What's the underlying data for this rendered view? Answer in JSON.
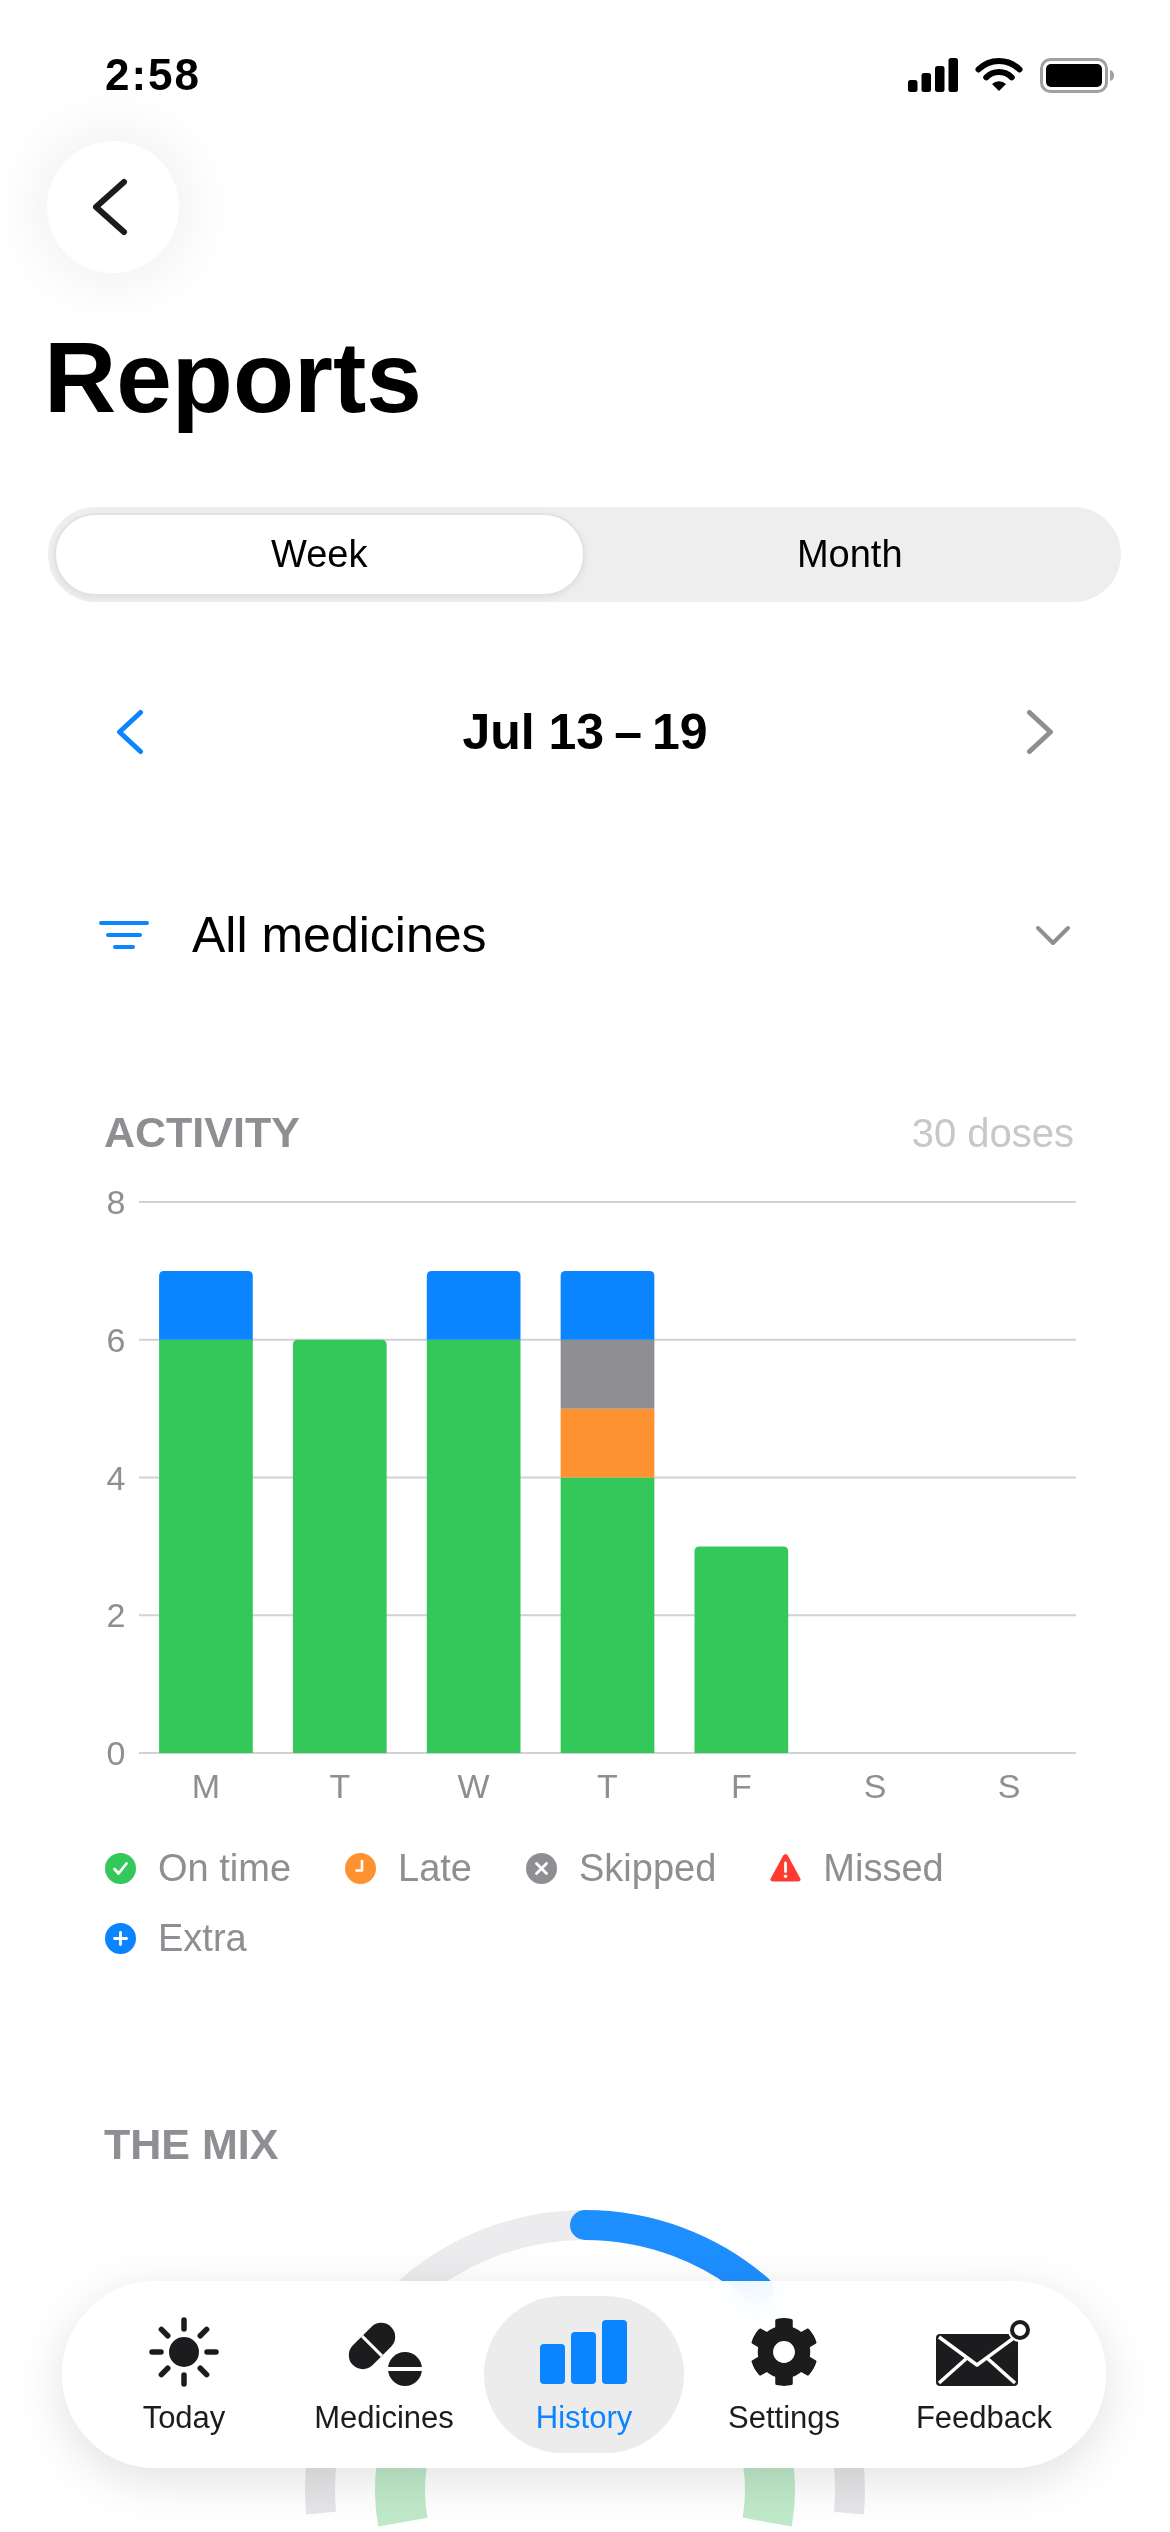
{
  "status_bar": {
    "time": "2:58"
  },
  "header": {
    "title": "Reports"
  },
  "period_tabs": [
    {
      "label": "Week",
      "selected": true
    },
    {
      "label": "Month",
      "selected": false
    }
  ],
  "date_nav": {
    "range": "Jul 13 – 19",
    "previous_disabled": false,
    "next_disabled": true
  },
  "filter": {
    "value": "All medicines"
  },
  "activity": {
    "title": "ACTIVITY",
    "total": "30 doses",
    "chart_data": {
      "type": "bar",
      "stacked": true,
      "grid": true,
      "categories": [
        "M",
        "T",
        "W",
        "T",
        "F",
        "S",
        "S"
      ],
      "series": [
        {
          "name": "On time",
          "color": "#34c759",
          "values": [
            6,
            6,
            6,
            4,
            3,
            0,
            0
          ]
        },
        {
          "name": "Late",
          "color": "#ff9230",
          "values": [
            0,
            0,
            0,
            1,
            0,
            0,
            0
          ]
        },
        {
          "name": "Skipped",
          "color": "#8e8e93",
          "values": [
            0,
            0,
            0,
            1,
            0,
            0,
            0
          ]
        },
        {
          "name": "Missed",
          "color": "#ff3b30",
          "values": [
            0,
            0,
            0,
            0,
            0,
            0,
            0
          ]
        },
        {
          "name": "Extra",
          "color": "#0a84ff",
          "values": [
            1,
            0,
            1,
            1,
            0,
            0,
            0
          ]
        }
      ],
      "ylim": [
        0,
        8
      ],
      "yticks": [
        0,
        2,
        4,
        6,
        8
      ]
    }
  },
  "mix": {
    "title": "THE MIX"
  },
  "tab_bar": [
    {
      "label": "Today",
      "selected": false
    },
    {
      "label": "Medicines",
      "selected": false
    },
    {
      "label": "History",
      "selected": true
    },
    {
      "label": "Settings",
      "selected": false
    },
    {
      "label": "Feedback",
      "selected": false
    }
  ]
}
